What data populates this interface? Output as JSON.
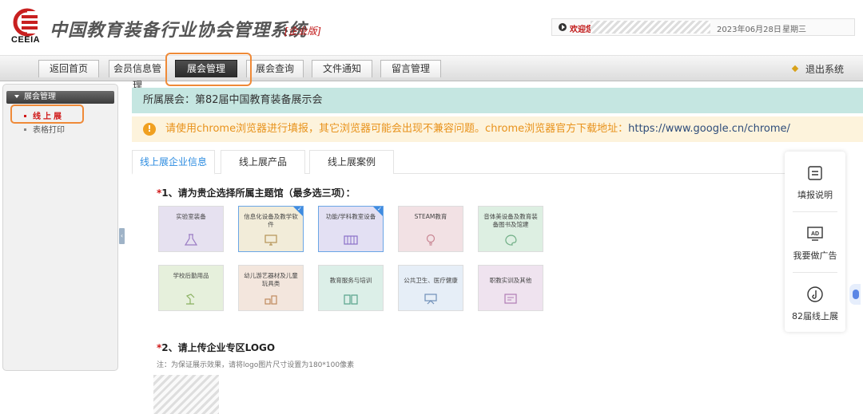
{
  "header": {
    "logo_text": "CEEIA",
    "title": "中国教育装备行业协会管理系统",
    "edition": "[企业版]",
    "welcome": "欢迎您",
    "date": "2023年06月28日",
    "weekday": "星期三"
  },
  "nav": {
    "tabs": [
      {
        "label": "返回首页"
      },
      {
        "label": "会员信息管理"
      },
      {
        "label": "展会管理"
      },
      {
        "label": "展会查询"
      },
      {
        "label": "文件通知"
      },
      {
        "label": "留言管理"
      }
    ],
    "active_index": 2,
    "logout": "退出系统"
  },
  "sidebar": {
    "section_title": "展会管理",
    "items": [
      {
        "label": "线上展",
        "active": true
      },
      {
        "label": "表格打印",
        "active": false
      }
    ],
    "toggle_glyph": "‹"
  },
  "main": {
    "exhibition_label": "所属展会：第82届中国教育装备展示会",
    "notice_icon": "!",
    "notice_text": "请使用chrome浏览器进行填报，其它浏览器可能会出现不兼容问题。chrome浏览器官方下载地址：",
    "notice_url": "https://www.google.cn/chrome/",
    "tabs": [
      {
        "label": "线上展企业信息",
        "active": true
      },
      {
        "label": "线上展产品",
        "active": false
      },
      {
        "label": "线上展案例",
        "active": false
      }
    ],
    "q1_star": "*",
    "q1_label": "1、请为贵企选择所属主题馆（最多选三项）：",
    "halls": [
      {
        "label": "实验室装备",
        "icon": "flask-icon",
        "selected": false,
        "bg": "#e6e1f0"
      },
      {
        "label": "信息化设备及教学软件",
        "icon": "monitor-icon",
        "selected": true,
        "bg": "#f2ecd9"
      },
      {
        "label": "功能/学科教室设备",
        "icon": "piano-icon",
        "selected": true,
        "bg": "#e3e0f3"
      },
      {
        "label": "STEAM教育",
        "icon": "lightbulb-icon",
        "selected": false,
        "bg": "#f2e1e4"
      },
      {
        "label": "音体美设备及教育装备图书及馆建",
        "icon": "palette-icon",
        "selected": false,
        "bg": "#ddefe2"
      },
      {
        "label": "学校后勤用品",
        "icon": "lamp-icon",
        "selected": false,
        "bg": "#e6f0dc"
      },
      {
        "label": "幼儿游艺器材及儿童玩具类",
        "icon": "blocks-icon",
        "selected": false,
        "bg": "#f3e6dd"
      },
      {
        "label": "教育服务与培训",
        "icon": "book-icon",
        "selected": false,
        "bg": "#dcefe8"
      },
      {
        "label": "公共卫生、医疗健康",
        "icon": "board-icon",
        "selected": false,
        "bg": "#e6eef7"
      },
      {
        "label": "职教实训及其他",
        "icon": "certificate-icon",
        "selected": false,
        "bg": "#efe3ef"
      }
    ],
    "q2_star": "*",
    "q2_label": "2、请上传企业专区LOGO",
    "q2_note": "注：为保证展示效果，请将logo图片尺寸设置为180*100像素"
  },
  "float_panel": {
    "items": [
      {
        "label": "填报说明",
        "icon": "doc-icon"
      },
      {
        "label": "我要做广告",
        "icon": "ad-icon"
      },
      {
        "label": "82届线上展",
        "icon": "music-icon"
      }
    ]
  },
  "colors": {
    "accent_blue": "#2d8ce0",
    "highlight_orange": "#ef8a38",
    "required_red": "#d01818",
    "notice_bg": "#fdf3dc",
    "exhibit_bar_bg": "#c5e6e1"
  }
}
